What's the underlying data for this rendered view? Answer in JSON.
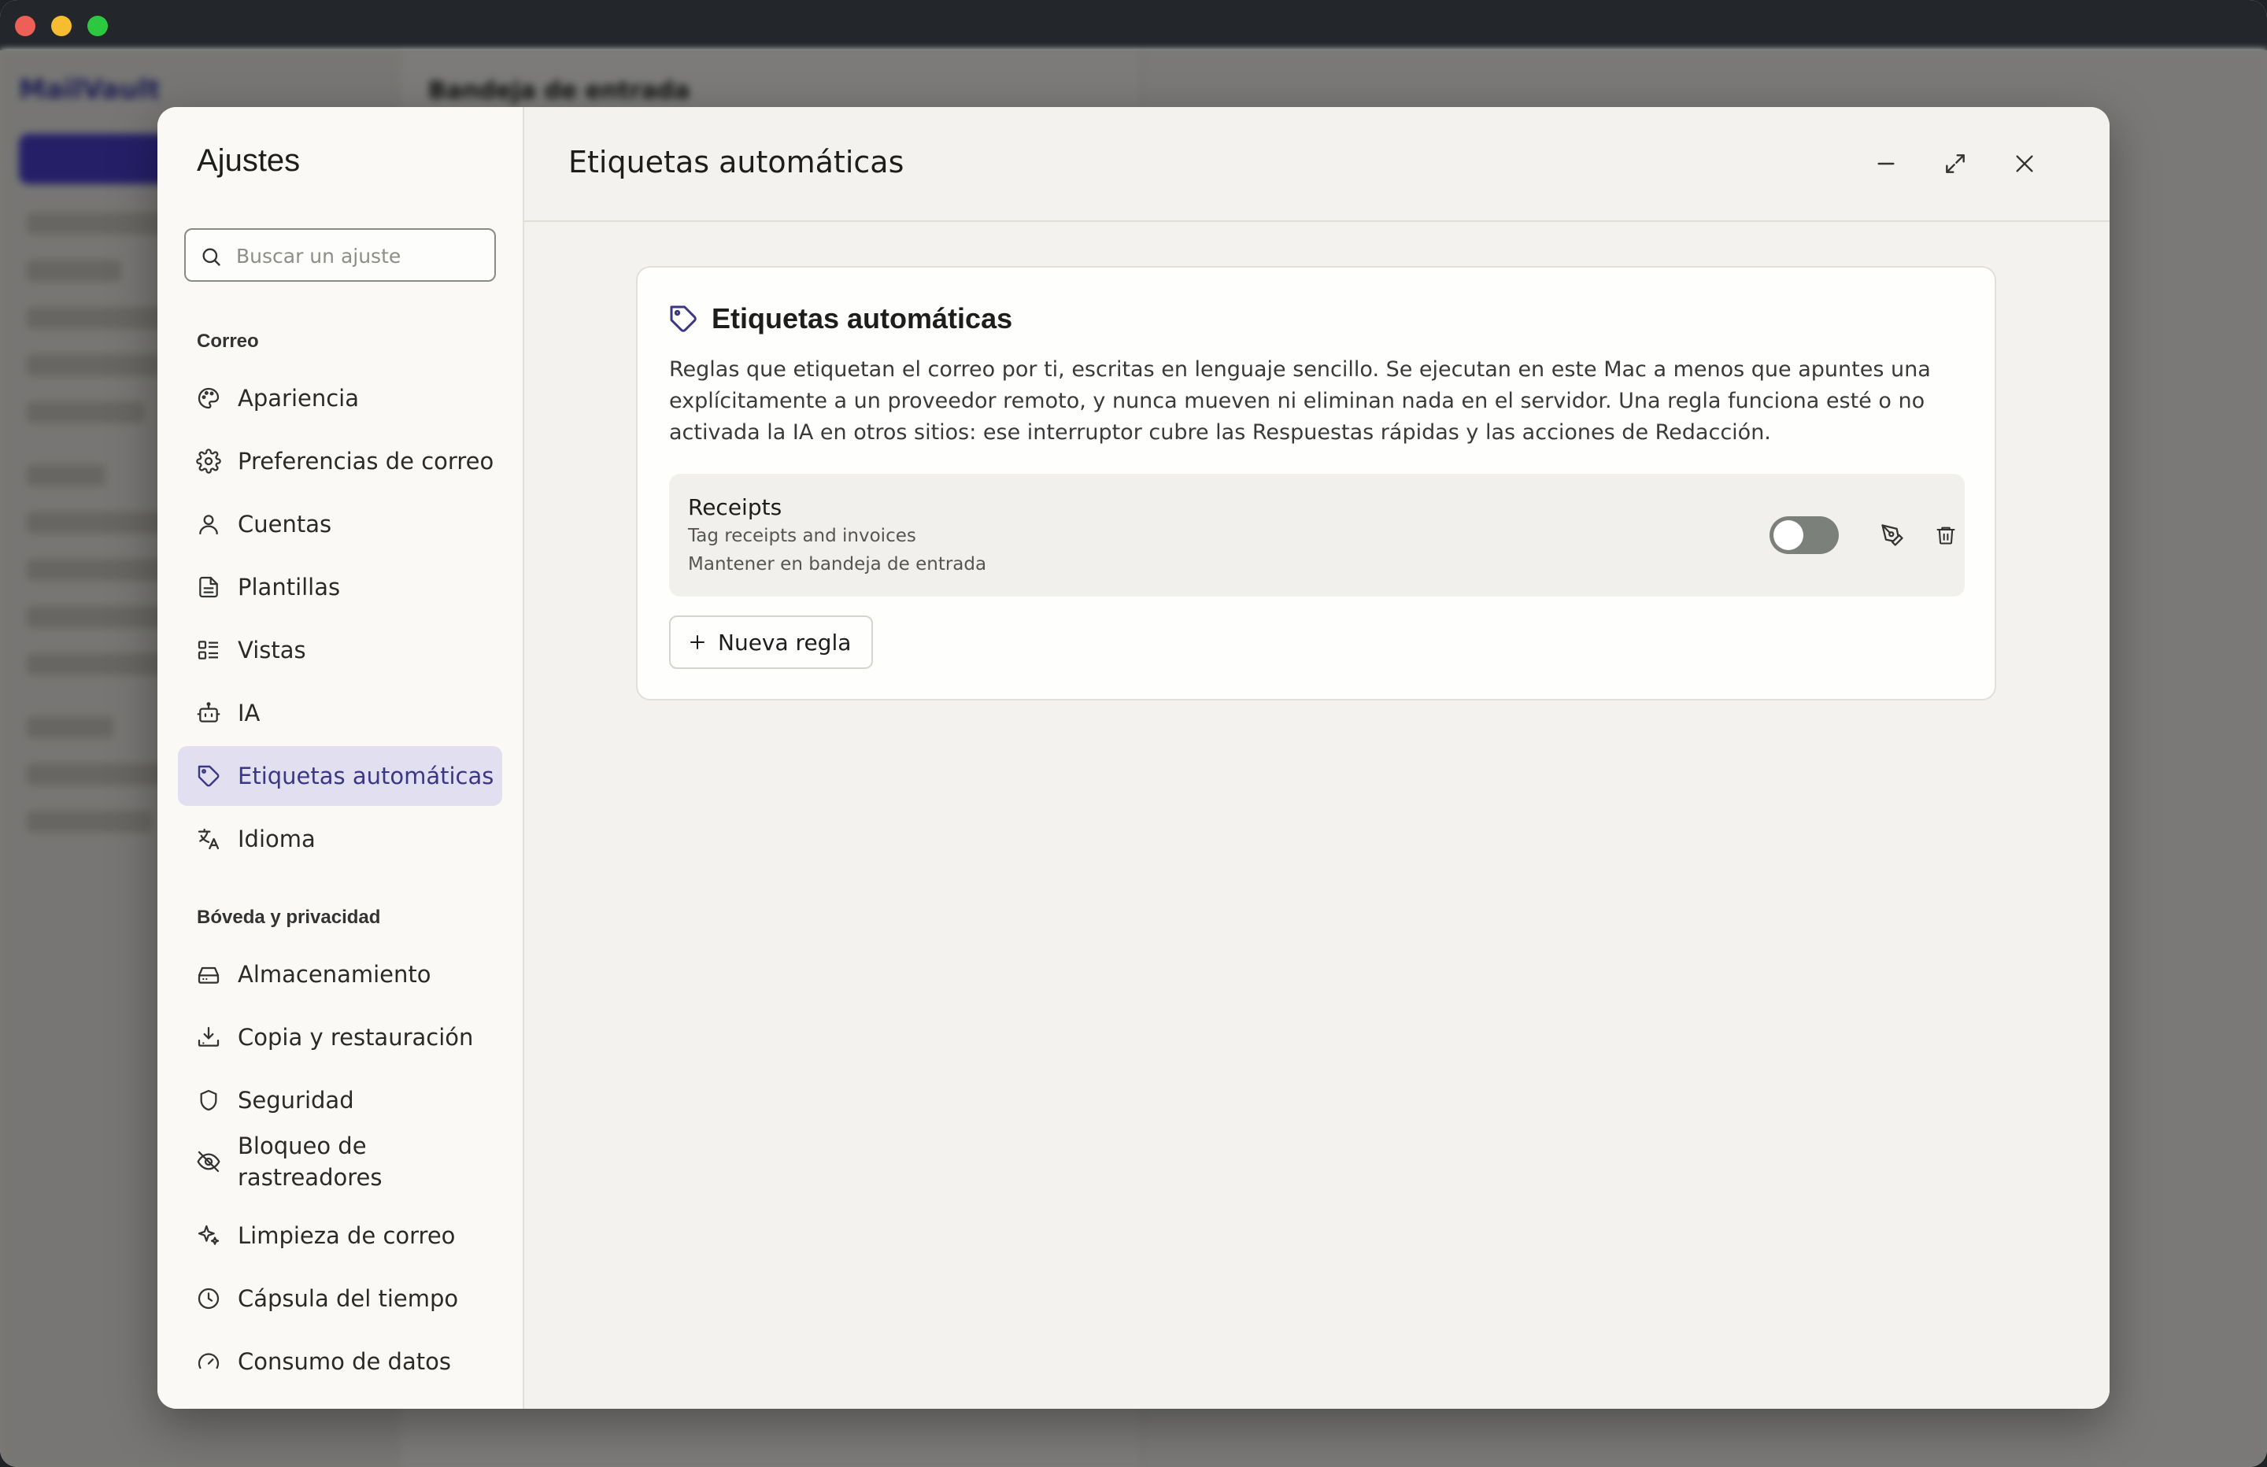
{
  "background_app": {
    "logo": "MailVault",
    "list_title": "Bandeja de entrada"
  },
  "settings": {
    "title": "Ajustes",
    "search_placeholder": "Buscar un ajuste",
    "sections": [
      {
        "label": "Correo",
        "items": [
          {
            "label": "Apariencia",
            "icon": "palette-icon"
          },
          {
            "label": "Preferencias de correo",
            "icon": "gear-icon"
          },
          {
            "label": "Cuentas",
            "icon": "user-icon"
          },
          {
            "label": "Plantillas",
            "icon": "document-icon"
          },
          {
            "label": "Vistas",
            "icon": "list-view-icon"
          },
          {
            "label": "IA",
            "icon": "robot-icon"
          },
          {
            "label": "Etiquetas automáticas",
            "icon": "tag-icon",
            "active": true
          },
          {
            "label": "Idioma",
            "icon": "translate-icon"
          }
        ]
      },
      {
        "label": "Bóveda y privacidad",
        "items": [
          {
            "label": "Almacenamiento",
            "icon": "drive-icon"
          },
          {
            "label": "Copia y restauración",
            "icon": "download-icon"
          },
          {
            "label": "Seguridad",
            "icon": "shield-icon"
          },
          {
            "label": "Bloqueo de rastreadores",
            "icon": "eye-off-icon"
          },
          {
            "label": "Limpieza de correo",
            "icon": "sparkles-icon"
          },
          {
            "label": "Cápsula del tiempo",
            "icon": "clock-icon"
          },
          {
            "label": "Consumo de datos",
            "icon": "gauge-icon"
          }
        ]
      }
    ]
  },
  "panel": {
    "title": "Etiquetas automáticas",
    "card": {
      "title": "Etiquetas automáticas",
      "description": "Reglas que etiquetan el correo por ti, escritas en lenguaje sencillo. Se ejecutan en este Mac a menos que apuntes una explícitamente a un proveedor remoto, y nunca mueven ni eliminan nada en el servidor. Una regla funciona esté o no activada la IA en otros sitios: ese interruptor cubre las Respuestas rápidas y las acciones de Redacción.",
      "rules": [
        {
          "name": "Receipts",
          "description": "Tag receipts and invoices",
          "action": "Mantener en bandeja de entrada",
          "enabled": false
        }
      ],
      "new_rule_label": "Nueva regla"
    }
  },
  "colors": {
    "accent": "#3a3785",
    "active_bg": "#e2dff0",
    "toggle_off": "#7c807a"
  }
}
